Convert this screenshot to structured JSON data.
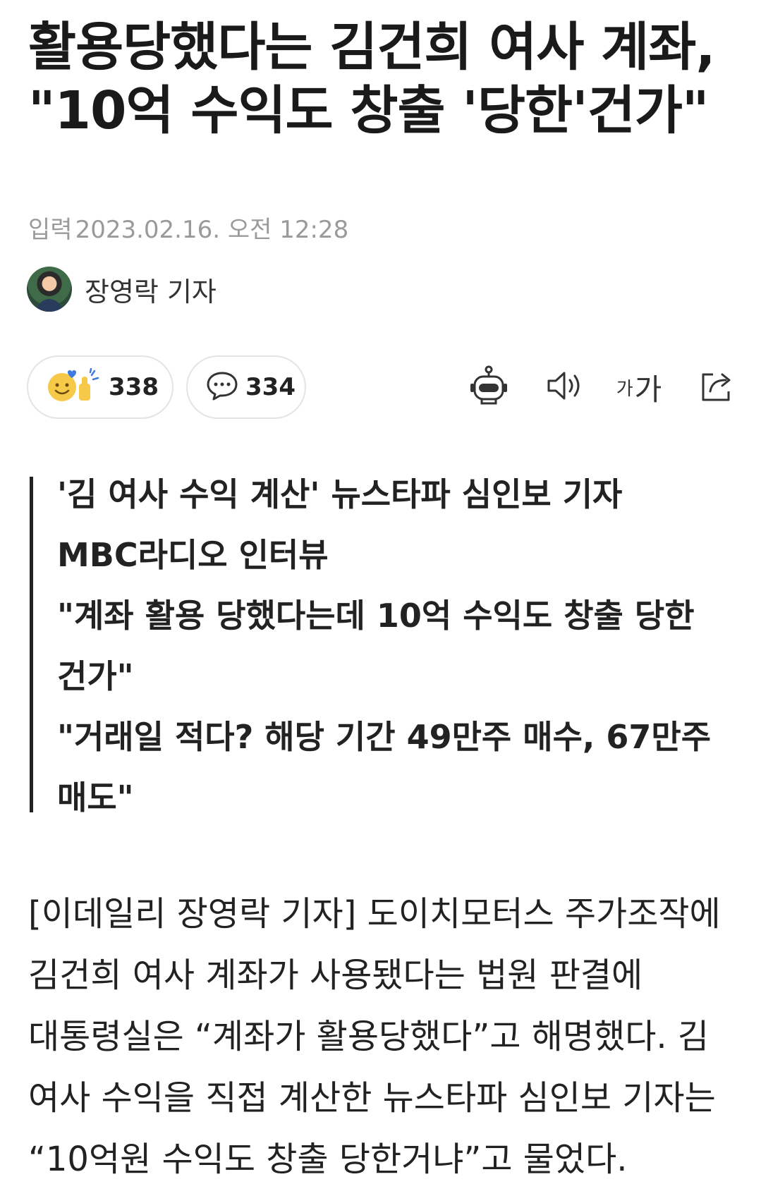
{
  "article": {
    "headline": "활용당했다는 김건희 여사 계좌, \"10억 수익도 창출 '당한'건가\"",
    "date_label": "입력",
    "date_value": "2023.02.16. 오전 12:28",
    "author": "장영락 기자"
  },
  "reactions": {
    "like_count": "338",
    "comment_count": "334"
  },
  "toolbar": {
    "font_small": "가",
    "font_large": "가"
  },
  "summary": {
    "lines": [
      "'김 여사 수익 계산' 뉴스타파 심인보 기자",
      "MBC라디오 인터뷰",
      "\"계좌 활용 당했다는데 10억 수익도 창출 당한 건가\"",
      "\"거래일 적다? 해당 기간 49만주 매수, 67만주 매도\""
    ]
  },
  "body": {
    "paragraph": "[이데일리 장영락 기자] 도이치모터스 주가조작에 김건희 여사 계좌가 사용됐다는 법원 판결에 대통령실은 “계좌가 활용당했다”고 해명했다. 김 여사 수익을 직접 계산한 뉴스타파 심인보 기자는 “10억원 수익도 창출 당한거냐”고 물었다."
  },
  "colors": {
    "text": "#222222",
    "muted": "#9a9a9a",
    "pill_border": "#e4e4e4",
    "emoji_yellow": "#f7c948",
    "emoji_blue": "#3d7be0"
  }
}
